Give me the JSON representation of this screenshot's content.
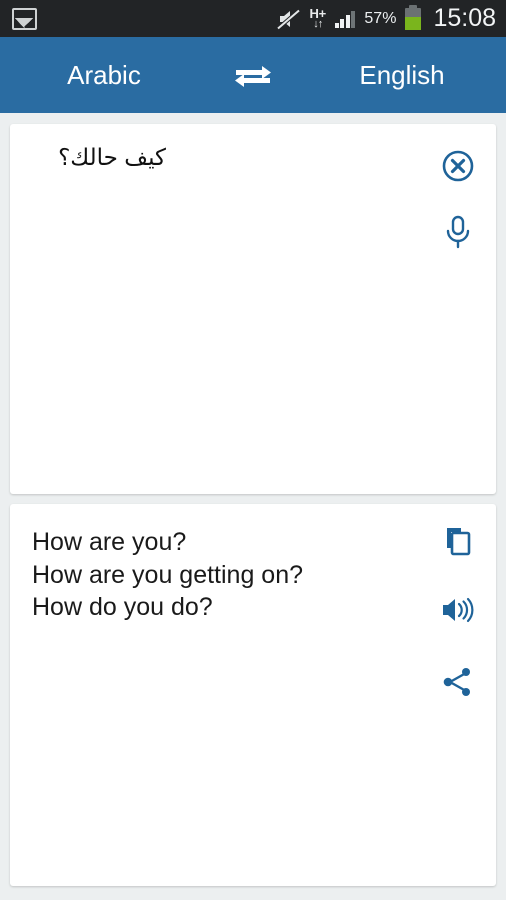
{
  "status_bar": {
    "notification_icon": "gallery-image-icon",
    "mute_icon": "sound-muted-icon",
    "network_type": "H+",
    "network_arrows": "↓↑",
    "signal_icon": "signal-bars-icon",
    "battery_percent_label": "57%",
    "battery_level": 57,
    "battery_icon": "battery-icon",
    "time": "15:08",
    "background_color": "#222426"
  },
  "header": {
    "source_language": "Arabic",
    "target_language": "English",
    "swap_icon": "swap-languages-icon",
    "background_color": "#2a6ca2",
    "text_color": "#ffffff"
  },
  "source_card": {
    "text": "كيف حالك؟",
    "placeholder": "",
    "actions": [
      {
        "name": "clear-button",
        "icon": "clear-circle-x-icon"
      },
      {
        "name": "voice-input-button",
        "icon": "microphone-icon"
      }
    ]
  },
  "target_card": {
    "translations": [
      "How are you?",
      "How are you getting on?",
      "How do you do?"
    ],
    "actions": [
      {
        "name": "copy-button",
        "icon": "copy-icon"
      },
      {
        "name": "speak-button",
        "icon": "speaker-volume-icon"
      },
      {
        "name": "share-button",
        "icon": "share-icon"
      }
    ]
  },
  "theme": {
    "accent_blue": "#2a6ca2",
    "icon_blue": "#1f6399",
    "page_background": "#eceff0",
    "card_background": "#ffffff",
    "battery_green": "#7ab51d"
  }
}
